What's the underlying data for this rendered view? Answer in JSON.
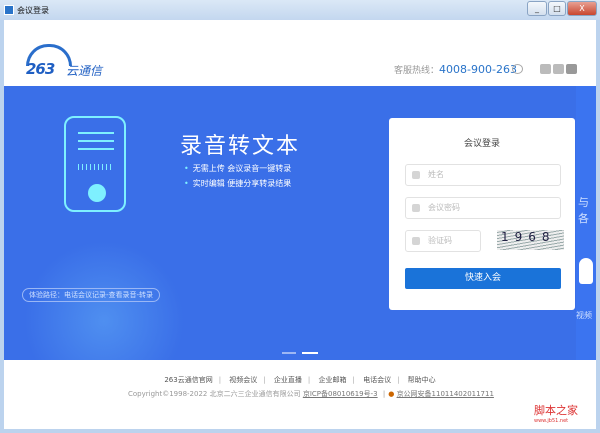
{
  "window": {
    "title": "会议登录",
    "min": "_",
    "max": "□",
    "close": "X"
  },
  "header": {
    "logo_num": "263",
    "logo_name": "云通信",
    "hotline_label": "客服热线：",
    "hotline_number": "4008-900-263"
  },
  "banner": {
    "title": "录音转文本",
    "bullets": [
      "无需上传  会议录音一键转录",
      "实时编辑  便捷分享转录结果"
    ],
    "path": "体验路径：电话会议记录-查看录音-转录",
    "side_text": "与各",
    "side_text2": "视频"
  },
  "login": {
    "title": "会议登录",
    "name_placeholder": "姓名",
    "password_placeholder": "会议密码",
    "captcha_placeholder": "验证码",
    "captcha_text": "1968",
    "submit": "快速入会"
  },
  "footer": {
    "links": [
      "263云通信官网",
      "视频会议",
      "企业直播",
      "企业邮箱",
      "电话会议",
      "帮助中心"
    ],
    "copyright": "Copyright©1998-2022 北京二六三企业通信有限公司",
    "icp": "京ICP备08010619号-3",
    "police": "京公网安备11011402011711"
  },
  "watermark": {
    "name": "脚本之家",
    "url": "www.jb51.net"
  }
}
